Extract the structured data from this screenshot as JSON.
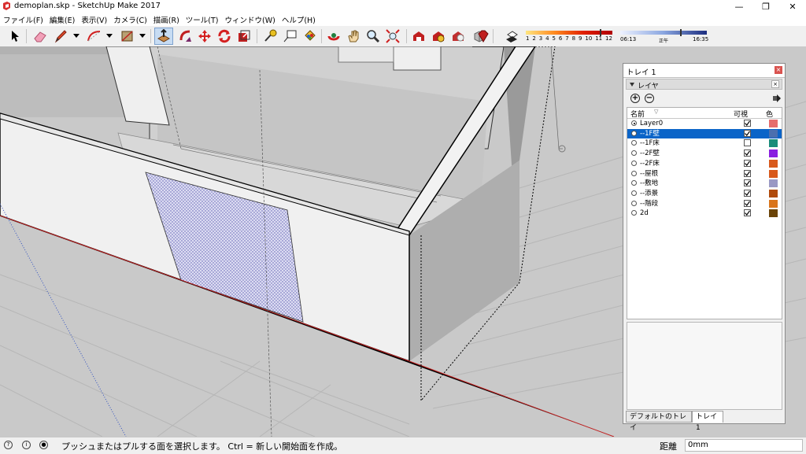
{
  "window": {
    "title": "demoplan.skp - SketchUp Make 2017"
  },
  "menu": [
    "ファイル(F)",
    "編集(E)",
    "表示(V)",
    "カメラ(C)",
    "描画(R)",
    "ツール(T)",
    "ウィンドウ(W)",
    "ヘルプ(H)"
  ],
  "shadow": {
    "month_ticks": [
      "1",
      "2",
      "3",
      "4",
      "5",
      "6",
      "7",
      "8",
      "9",
      "10",
      "11",
      "12"
    ],
    "time_start": "06:13",
    "time_noon": "正午",
    "time_end": "16:35"
  },
  "tray": {
    "title": "トレイ 1",
    "panel_title": "レイヤ",
    "col_name": "名前",
    "col_visible": "可視",
    "col_color": "色",
    "layers": [
      {
        "name": "Layer0",
        "active": true,
        "visible": true,
        "color": "#e66d6d",
        "selected": false
      },
      {
        "name": "--1F壁",
        "active": false,
        "visible": true,
        "color": "#4b6fae",
        "selected": true
      },
      {
        "name": "--1F床",
        "active": false,
        "visible": false,
        "color": "#1a8c7a",
        "selected": false
      },
      {
        "name": "--2F壁",
        "active": false,
        "visible": true,
        "color": "#8a1ee0",
        "selected": false
      },
      {
        "name": "--2F床",
        "active": false,
        "visible": true,
        "color": "#d8591c",
        "selected": false
      },
      {
        "name": "--屋根",
        "active": false,
        "visible": true,
        "color": "#d8591c",
        "selected": false
      },
      {
        "name": "--敷地",
        "active": false,
        "visible": true,
        "color": "#9a98c4",
        "selected": false
      },
      {
        "name": "--添景",
        "active": false,
        "visible": true,
        "color": "#b04a0a",
        "selected": false
      },
      {
        "name": "--階段",
        "active": false,
        "visible": true,
        "color": "#d9751c",
        "selected": false
      },
      {
        "name": "2d",
        "active": false,
        "visible": true,
        "color": "#6b4408",
        "selected": false
      }
    ],
    "tabs": [
      "デフォルトのトレイ",
      "トレイ 1"
    ]
  },
  "status": {
    "message": "プッシュまたはプルする面を選択します。 Ctrl = 新しい開始面を作成。",
    "measure_label": "距離",
    "measure_value": "0mm"
  }
}
